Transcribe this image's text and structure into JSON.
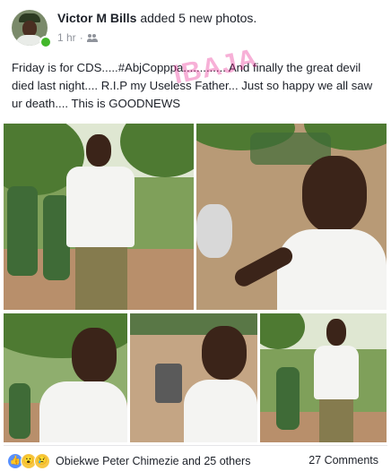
{
  "header": {
    "author": "Victor M Bills",
    "action": "added 5 new photos.",
    "time": "1 hr",
    "separator": "·",
    "audience_icon": "friends-icon"
  },
  "post": {
    "text": "Friday is for CDS.....#AbjCopppa............. And finally the great devil died last night.... R.I.P my Useless Father... Just so happy we all saw ur death.... This is GOODNEWS",
    "watermark": "IBAJA"
  },
  "reactions": {
    "icons": [
      "like-icon",
      "wow-icon",
      "sad-icon"
    ],
    "like_glyph": "👍",
    "wow_glyph": "😮",
    "sad_glyph": "😢",
    "reactors": "Obiekwe Peter Chimezie and 25 others",
    "comments": "27 Comments"
  },
  "colors": {
    "text": "#1d2129",
    "meta": "#90949c",
    "online": "#42b72a",
    "like": "#5890ff",
    "watermark": "#e91e8c"
  }
}
